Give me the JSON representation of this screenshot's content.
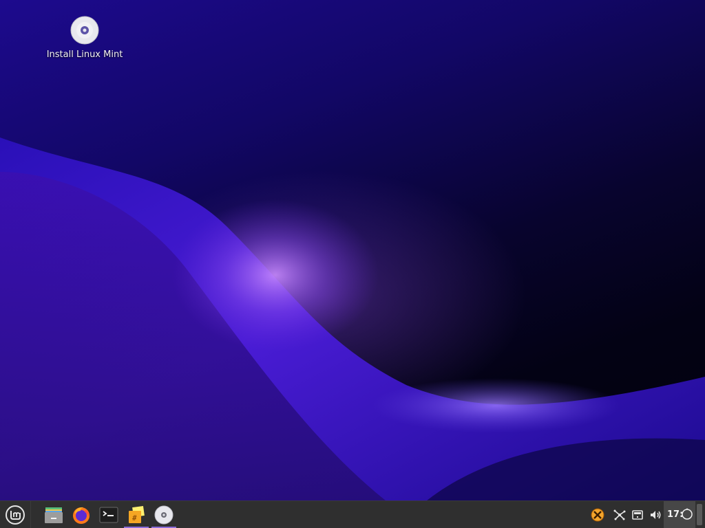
{
  "desktop": {
    "icons": [
      {
        "label": "Install Linux Mint",
        "icon": "install-disc-icon"
      }
    ]
  },
  "panel": {
    "menu": {
      "icon": "linux-mint-logo-icon"
    },
    "launchers": [
      {
        "icon": "file-manager-icon",
        "active": false
      },
      {
        "icon": "firefox-icon",
        "active": false
      },
      {
        "icon": "terminal-icon",
        "active": false
      },
      {
        "icon": "xed-text-editor-icon",
        "active": true
      },
      {
        "icon": "install-disc-icon",
        "active": true
      }
    ],
    "tray": [
      {
        "icon": "xapp-status-icon"
      },
      {
        "icon": "network-icon"
      },
      {
        "icon": "removable-drive-icon"
      },
      {
        "icon": "volume-icon"
      }
    ],
    "clock": "17:",
    "notifications_icon": "notifications-icon"
  },
  "colors": {
    "panel_bg": "#2f2f2f",
    "active_indicator": "#8b6cd9",
    "wallpaper_deep": "#02010d",
    "wallpaper_violet": "#1d0a8e"
  }
}
